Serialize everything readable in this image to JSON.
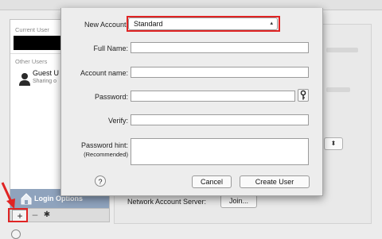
{
  "users_list": {
    "current_user_header": "Current User",
    "other_users_header": "Other Users",
    "guest_name": "Guest U",
    "guest_status": "Sharing o",
    "login_options": "Login Options",
    "add_label": "+",
    "remove_label": "–",
    "gear_label": "✱"
  },
  "network_server": {
    "label": "Network Account Server:",
    "join_label": "Join..."
  },
  "dialog": {
    "new_account_label": "New Account:",
    "new_account_value": "Standard",
    "full_name_label": "Full Name:",
    "account_name_label": "Account name:",
    "password_label": "Password:",
    "verify_label": "Verify:",
    "password_hint_label": "Password hint:",
    "password_hint_sub": "(Recommended)",
    "help_label": "?",
    "cancel_label": "Cancel",
    "create_user_label": "Create User",
    "full_name_value": "",
    "account_name_value": "",
    "password_value": "",
    "verify_value": "",
    "password_hint_value": ""
  },
  "colors": {
    "highlight": "#e02424",
    "selection": "#8fa3bd"
  }
}
